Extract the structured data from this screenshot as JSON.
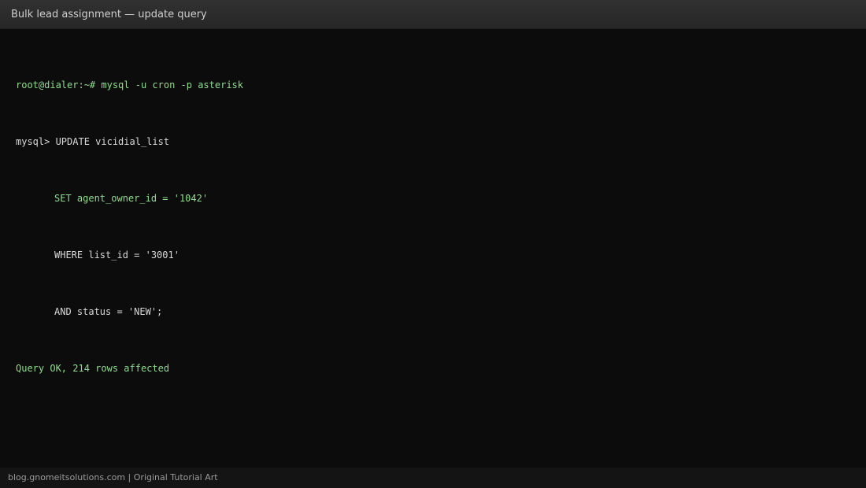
{
  "window": {
    "title": "Bulk lead assignment — update query"
  },
  "terminal": {
    "lines": [
      {
        "prompt": "root@dialer:~# ",
        "text": "mysql -u cron -p asterisk"
      },
      {
        "prompt": "mysql> ",
        "text": "UPDATE vicidial_list"
      },
      {
        "prompt": "",
        "text": "SET agent_owner_id = '1042'"
      },
      {
        "prompt": "",
        "text": "WHERE list_id = '3001'"
      },
      {
        "prompt": "",
        "text": "AND status = 'NEW';"
      },
      {
        "prompt": "",
        "text": "Query OK, 214 rows affected"
      }
    ]
  },
  "footer": {
    "text": "blog.gnomeitsolutions.com | Original Tutorial Art"
  },
  "colors": {
    "background": "#0c0c0c",
    "titlebar": "#2b2b2b",
    "green_text": "#8fdc8f",
    "white_text": "#d8d8d8"
  }
}
